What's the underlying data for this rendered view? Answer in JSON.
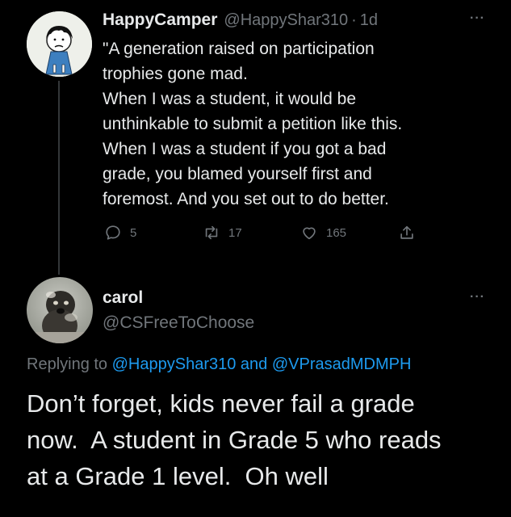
{
  "parent_tweet": {
    "display_name": "HappyCamper",
    "handle": "@HappyShar310",
    "separator": "·",
    "time": "1d",
    "more": "···",
    "text_lines": [
      "\"A generation raised on participation",
      "trophies gone mad.",
      "When I was a student, it would be",
      "unthinkable to submit a petition like this.",
      "When I was a student if you got a bad",
      "grade, you blamed yourself first and",
      "foremost. And you set out to do better."
    ],
    "actions": {
      "replies": "5",
      "retweets": "17",
      "likes": "165"
    }
  },
  "reply_tweet": {
    "display_name": "carol",
    "handle": "@CSFreeToChoose",
    "more": "···",
    "replying_prefix": "Replying to",
    "replying_to_1": "@HappyShar310",
    "replying_and": "and",
    "replying_to_2": "@VPrasadMDMPH",
    "text_lines": [
      "Don’t forget, kids never fail a grade",
      "now.  A student in Grade 5 who reads",
      "at a Grade 1 level.  Oh well"
    ]
  },
  "colors": {
    "background": "#000000",
    "text": "#e7e9ea",
    "muted": "#71767b",
    "link": "#1d9bf0",
    "thread_line": "#333639"
  },
  "icons": {
    "reply": "reply-icon",
    "retweet": "retweet-icon",
    "like": "heart-icon",
    "share": "share-icon"
  }
}
